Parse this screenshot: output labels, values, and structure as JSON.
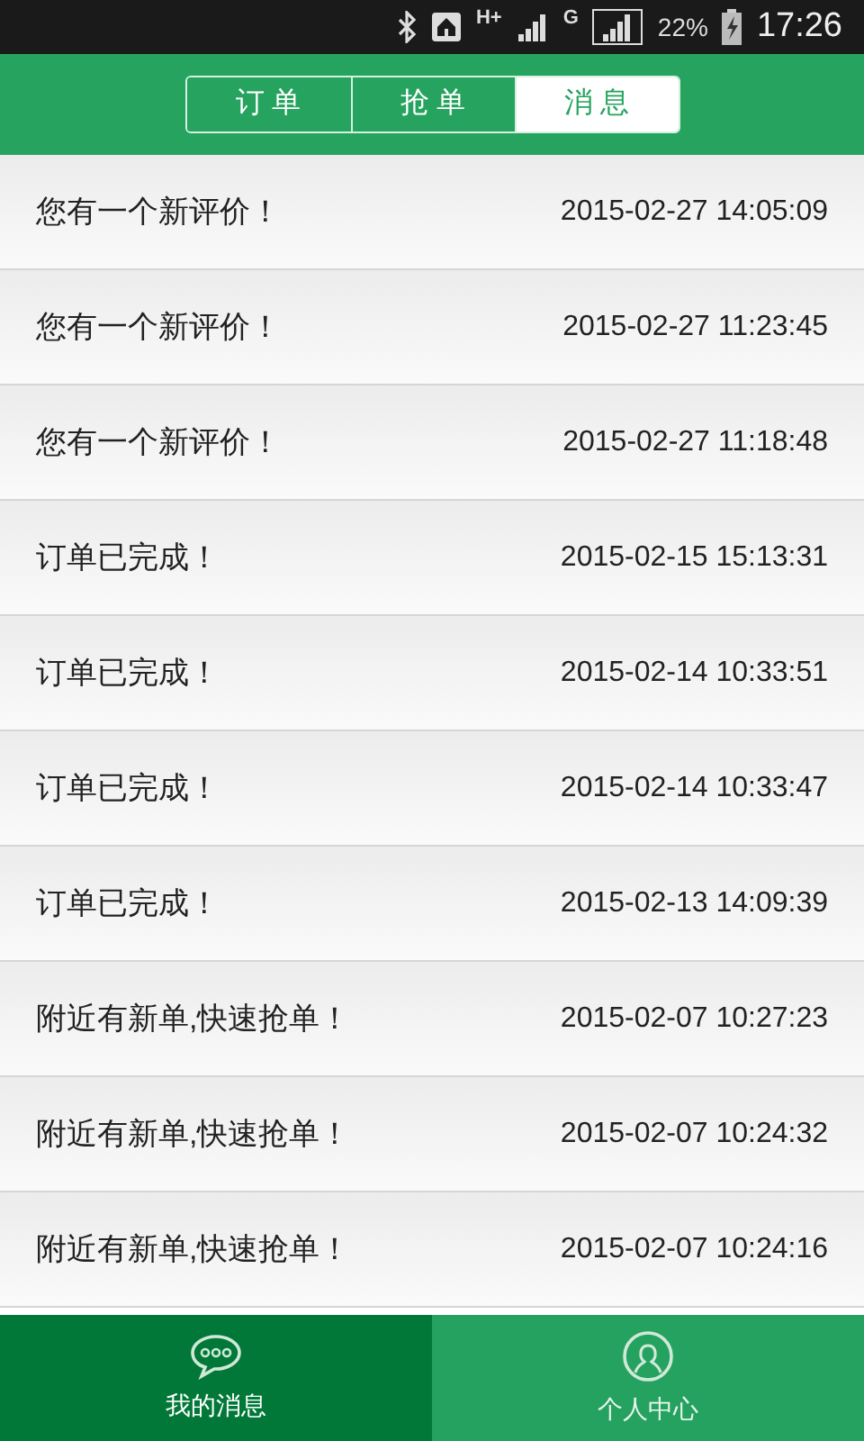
{
  "status_bar": {
    "network_1": "H+",
    "network_2": "G",
    "battery": "22%",
    "time": "17:26"
  },
  "tabs": [
    {
      "label": "订 单",
      "selected": false
    },
    {
      "label": "抢 单",
      "selected": false
    },
    {
      "label": "消 息",
      "selected": true
    }
  ],
  "messages": [
    {
      "text": "您有一个新评价！",
      "time": "2015-02-27 14:05:09"
    },
    {
      "text": "您有一个新评价！",
      "time": "2015-02-27 11:23:45"
    },
    {
      "text": "您有一个新评价！",
      "time": "2015-02-27 11:18:48"
    },
    {
      "text": "订单已完成！",
      "time": "2015-02-15 15:13:31"
    },
    {
      "text": "订单已完成！",
      "time": "2015-02-14 10:33:51"
    },
    {
      "text": "订单已完成！",
      "time": "2015-02-14 10:33:47"
    },
    {
      "text": "订单已完成！",
      "time": "2015-02-13 14:09:39"
    },
    {
      "text": "附近有新单,快速抢单！",
      "time": "2015-02-07 10:27:23"
    },
    {
      "text": "附近有新单,快速抢单！",
      "time": "2015-02-07 10:24:32"
    },
    {
      "text": "附近有新单,快速抢单！",
      "time": "2015-02-07 10:24:16"
    }
  ],
  "bottom_nav": [
    {
      "kind": "chat",
      "label": "我的消息",
      "selected": true
    },
    {
      "kind": "person",
      "label": "个人中心",
      "selected": false
    }
  ]
}
